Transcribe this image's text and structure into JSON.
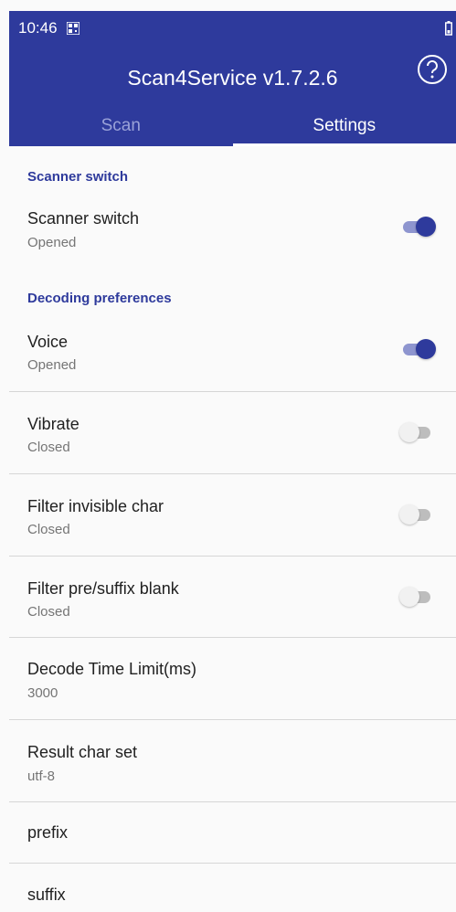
{
  "status_bar": {
    "time": "10:46",
    "notification_icon": "qr-code-icon",
    "battery_icon": "battery-icon"
  },
  "toolbar": {
    "title": "Scan4Service v1.7.2.6",
    "help_icon": "help-icon"
  },
  "tabs": [
    {
      "label": "Scan",
      "active": false
    },
    {
      "label": "Settings",
      "active": true
    }
  ],
  "colors": {
    "primary": "#2e3a9c",
    "accent_track": "#8e95cf",
    "background": "#fafafa",
    "category_text": "#2e3a9c"
  },
  "settings": {
    "category_scanner": "Scanner switch",
    "scanner_switch": {
      "title": "Scanner switch",
      "summary": "Opened",
      "checked": true
    },
    "category_decoding": "Decoding preferences",
    "voice": {
      "title": "Voice",
      "summary": "Opened",
      "checked": true
    },
    "vibrate": {
      "title": "Vibrate",
      "summary": "Closed",
      "checked": false
    },
    "filter_invisible": {
      "title": "Filter invisible char",
      "summary": "Closed",
      "checked": false
    },
    "filter_blank": {
      "title": "Filter pre/suffix blank",
      "summary": "Closed",
      "checked": false
    },
    "decode_time": {
      "title": "Decode Time Limit(ms)",
      "summary": "3000"
    },
    "charset": {
      "title": "Result char set",
      "summary": "utf-8"
    },
    "prefix": {
      "title": "prefix"
    },
    "suffix": {
      "title": "suffix"
    }
  }
}
